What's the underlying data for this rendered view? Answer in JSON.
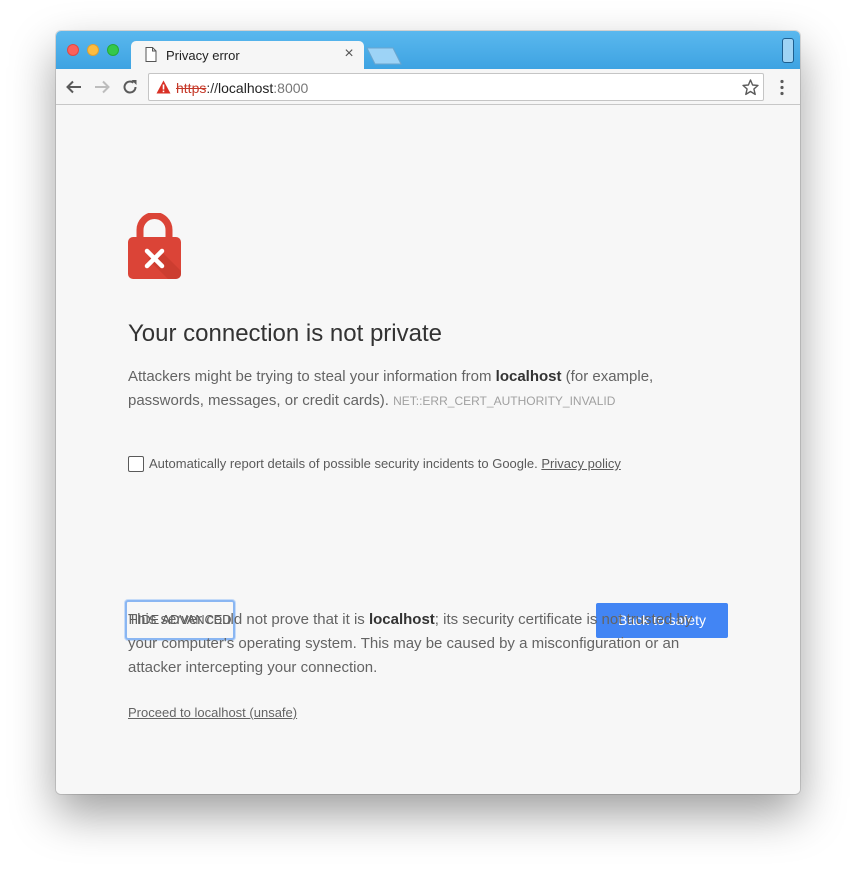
{
  "browser": {
    "tab": {
      "title": "Privacy error",
      "close": "×"
    },
    "address_bar": {
      "scheme": "https",
      "separator": "://",
      "host": "localhost",
      "port": ":8000"
    }
  },
  "page": {
    "heading": "Your connection is not private",
    "description": {
      "before": "Attackers might be trying to steal your information from ",
      "host": "localhost",
      "after": " (for example, passwords, messages, or credit cards). ",
      "error_code": "NET::ERR_CERT_AUTHORITY_INVALID"
    },
    "report_checkbox": {
      "checked": false,
      "label": "Automatically report details of possible security incidents to Google. ",
      "link": "Privacy policy"
    },
    "buttons": {
      "hide_advanced": "HIDE ADVANCED",
      "back_to_safety": "Back to safety"
    },
    "details": {
      "before": "This server could not prove that it is ",
      "host": "localhost",
      "after": "; its security certificate is not trusted by your computer's operating system. This may be caused by a misconfiguration or an attacker intercepting your connection."
    },
    "proceed_link": "Proceed to localhost (unsafe)"
  },
  "colors": {
    "accent": "#4285f4",
    "titlebar": "#3ea3e2",
    "lock": "#db4437"
  }
}
